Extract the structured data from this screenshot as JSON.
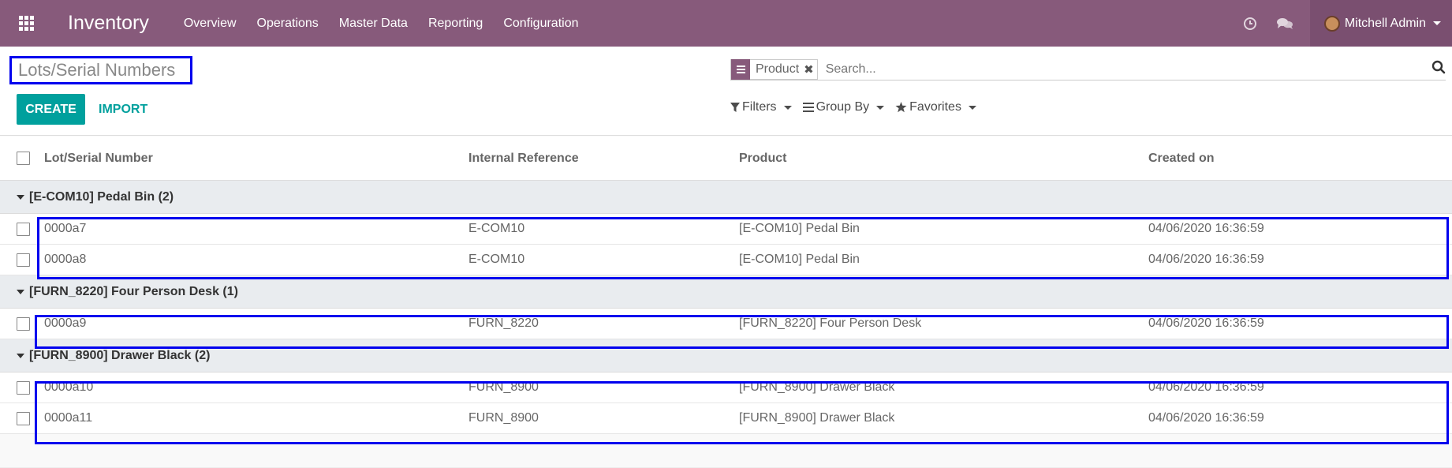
{
  "navbar": {
    "app_name": "Inventory",
    "menu": [
      "Overview",
      "Operations",
      "Master Data",
      "Reporting",
      "Configuration"
    ],
    "user_name": "Mitchell Admin",
    "icons": [
      "apps-grid-icon",
      "clock-icon",
      "chat-icon"
    ]
  },
  "page": {
    "title": "Lots/Serial Numbers",
    "create_label": "CREATE",
    "import_label": "IMPORT"
  },
  "search": {
    "facet_label": "Product",
    "placeholder": "Search...",
    "filters_label": "Filters",
    "groupby_label": "Group By",
    "favorites_label": "Favorites"
  },
  "table": {
    "columns": [
      "Lot/Serial Number",
      "Internal Reference",
      "Product",
      "Created on"
    ],
    "groups": [
      {
        "label": "[E-COM10] Pedal Bin (2)",
        "rows": [
          {
            "lot": "0000a7",
            "ref": "E-COM10",
            "product": "[E-COM10] Pedal Bin",
            "created": "04/06/2020 16:36:59"
          },
          {
            "lot": "0000a8",
            "ref": "E-COM10",
            "product": "[E-COM10] Pedal Bin",
            "created": "04/06/2020 16:36:59"
          }
        ]
      },
      {
        "label": "[FURN_8220] Four Person Desk (1)",
        "rows": [
          {
            "lot": "0000a9",
            "ref": "FURN_8220",
            "product": "[FURN_8220] Four Person Desk",
            "created": "04/06/2020 16:36:59"
          }
        ]
      },
      {
        "label": "[FURN_8900] Drawer Black (2)",
        "rows": [
          {
            "lot": "0000a10",
            "ref": "FURN_8900",
            "product": "[FURN_8900] Drawer Black",
            "created": "04/06/2020 16:36:59"
          },
          {
            "lot": "0000a11",
            "ref": "FURN_8900",
            "product": "[FURN_8900] Drawer Black",
            "created": "04/06/2020 16:36:59"
          }
        ]
      }
    ]
  },
  "colors": {
    "brand": "#875a7b",
    "primary": "#00a09d",
    "highlight": "#0000ee"
  }
}
